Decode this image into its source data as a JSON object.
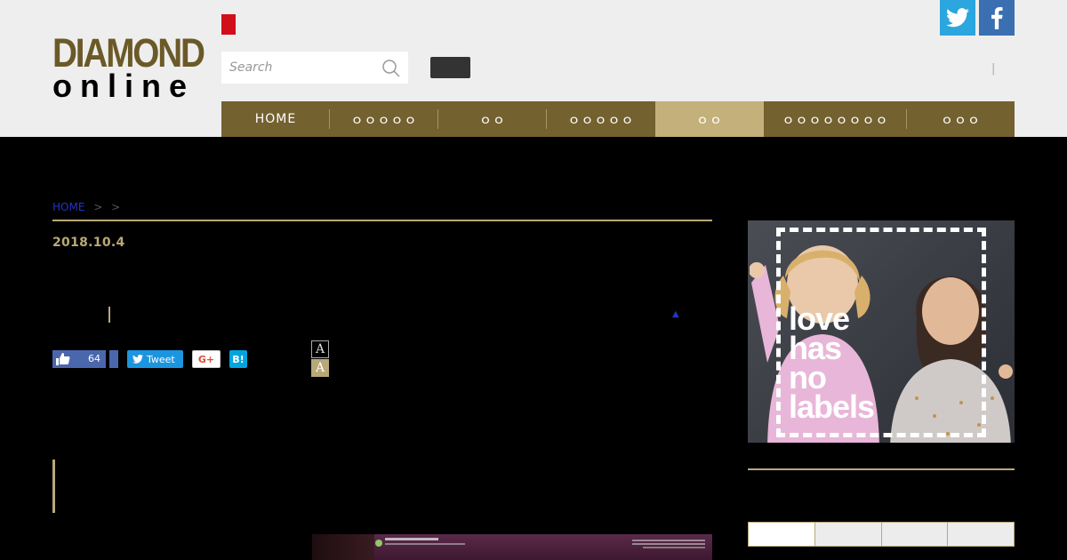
{
  "brand": {
    "logo_line1": "DIAMOND",
    "logo_line2": "online",
    "accent": "#736130",
    "accent_light": "#c3b07a"
  },
  "header": {
    "search_placeholder": "Search",
    "separator": "|"
  },
  "social": {
    "twitter_icon": "twitter-bird-icon",
    "facebook_icon": "facebook-f-icon"
  },
  "nav": {
    "items": [
      {
        "label": "HOME"
      },
      {
        "label": "ｏｏｏｏｏ"
      },
      {
        "label": "ｏｏ"
      },
      {
        "label": "ｏｏｏｏｏ"
      },
      {
        "label": "ｏｏ"
      },
      {
        "label": "ｏｏｏｏｏｏｏｏ"
      },
      {
        "label": "ｏｏｏ"
      }
    ],
    "active_index": 4
  },
  "breadcrumb": {
    "home": "HOME",
    "sep1": ">",
    "sep2": ">"
  },
  "article": {
    "date": "2018.10.4"
  },
  "share": {
    "like_count": "64",
    "tweet_label": "Tweet",
    "gplus_label": "G+",
    "hatena_label": "B!"
  },
  "font_size": {
    "small_label": "A",
    "large_label": "A"
  },
  "ad": {
    "text_line1": "love",
    "text_line2": "has",
    "text_line3": "no",
    "text_line4": "labels"
  }
}
